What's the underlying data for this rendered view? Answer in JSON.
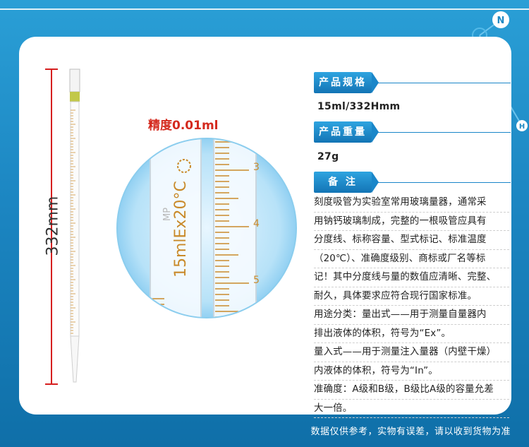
{
  "length_label": "332mm",
  "precision_label": "精度0.01ml",
  "pipette_marking": "15mlEx20°C",
  "pipette_brand": "MP",
  "zoom_scale_numbers": [
    "3",
    "4",
    "5"
  ],
  "specs": {
    "spec_title": "产品规格",
    "spec_value": "15ml/332Hmm",
    "weight_title": "产品重量",
    "weight_value": "27g",
    "note_title": "备 注"
  },
  "notes": [
    "刻度吸管为实验室常用玻璃量器，通常采",
    "用钠钙玻璃制成，完整的一根吸管应具有",
    "分度线、标称容量、型式标记、标准温度",
    "（20℃）、准确度级别、商标或厂名等标",
    "记！其中分度线与量的数值应清晰、完整、",
    "耐久，具体要求应符合现行国家标准。",
    "用途分类：量出式——用于测量自量器内",
    "排出液体的体积，符号为“Ex”。",
    "量入式——用于测量注入量器（内壁干燥）",
    "内液体的体积，符号为“In”。",
    "准确度：A级和B级，B级比A级的容量允差",
    "大一倍。"
  ],
  "footer": "数据仅供参考，实物有误差，请以收到货物为准",
  "molecule_letters": [
    "N",
    "H"
  ],
  "colors": {
    "background": "#1f8ac4",
    "accent": "#1a86c9",
    "precision_red": "#d42a1e",
    "graduation": "#c98a2a"
  }
}
